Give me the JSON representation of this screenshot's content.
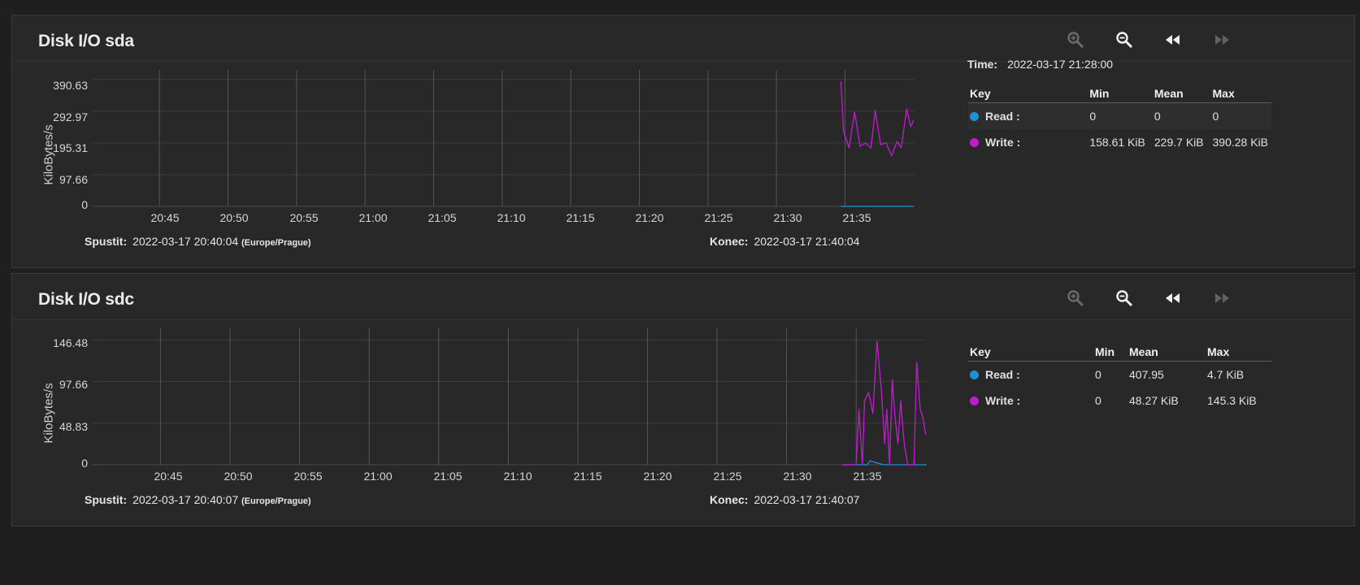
{
  "toolbar": {
    "zoom_in_icon": "zoom-in-icon",
    "zoom_out_icon": "zoom-out-icon",
    "back_icon": "rewind-icon",
    "forward_icon": "fast-forward-icon"
  },
  "colors": {
    "read": "#1a93d6",
    "write": "#c21ad1",
    "grid": "#3c3c3c",
    "vgrid": "#555555"
  },
  "legend_headers": {
    "key": "Key",
    "min": "Min",
    "mean": "Mean",
    "max": "Max"
  },
  "panels": [
    {
      "title": "Disk I/O sda",
      "ylabel": "KiloBytes/s",
      "time_label": "Time:",
      "time_value": "2022-03-17 21:28:00",
      "start_label": "Spustit:",
      "start_value": "2022-03-17 20:40:04",
      "start_tz": "(Europe/Prague)",
      "end_label": "Konec:",
      "end_value": "2022-03-17 21:40:04",
      "legend": [
        {
          "key": "Read :",
          "min": "0",
          "mean": "0",
          "max": "0"
        },
        {
          "key": "Write :",
          "min": "158.61 KiB",
          "mean": "229.7 KiB",
          "max": "390.28 KiB"
        }
      ]
    },
    {
      "title": "Disk I/O sdc",
      "ylabel": "KiloBytes/s",
      "start_label": "Spustit:",
      "start_value": "2022-03-17 20:40:07",
      "start_tz": "(Europe/Prague)",
      "end_label": "Konec:",
      "end_value": "2022-03-17 21:40:07",
      "legend": [
        {
          "key": "Read :",
          "min": "0",
          "mean": "407.95",
          "max": "4.7 KiB"
        },
        {
          "key": "Write :",
          "min": "0",
          "mean": "48.27 KiB",
          "max": "145.3 KiB"
        }
      ]
    }
  ],
  "chart_data": [
    {
      "type": "line",
      "x_ticks": [
        "20:45",
        "20:50",
        "20:55",
        "21:00",
        "21:05",
        "21:10",
        "21:15",
        "21:20",
        "21:25",
        "21:30",
        "21:35"
      ],
      "y_ticks": [
        "390.63",
        "292.97",
        "195.31",
        "97.66",
        "0"
      ],
      "y_tick_values": [
        390.63,
        292.97,
        195.31,
        97.66,
        0
      ],
      "ylabel": "KiloBytes/s",
      "xlim_minutes": [
        40.07,
        100.07
      ],
      "ylim": [
        0,
        420
      ],
      "series": [
        {
          "name": "Read",
          "x_minutes": [
            94.7,
            100.0
          ],
          "values": [
            0,
            0
          ]
        },
        {
          "name": "Write",
          "x_minutes": [
            94.7,
            94.9,
            95.3,
            95.7,
            96.1,
            96.5,
            96.9,
            97.2,
            97.6,
            98.0,
            98.4,
            98.8,
            99.1,
            99.5,
            99.8,
            100.0
          ],
          "values": [
            385,
            230,
            180,
            290,
            185,
            195,
            180,
            295,
            190,
            195,
            155,
            200,
            180,
            300,
            245,
            265
          ]
        }
      ]
    },
    {
      "type": "line",
      "x_ticks": [
        "20:45",
        "20:50",
        "20:55",
        "21:00",
        "21:05",
        "21:10",
        "21:15",
        "21:20",
        "21:25",
        "21:30",
        "21:35"
      ],
      "y_ticks": [
        "146.48",
        "97.66",
        "48.83",
        "0"
      ],
      "y_tick_values": [
        146.48,
        97.66,
        48.83,
        0
      ],
      "ylabel": "KiloBytes/s",
      "xlim_minutes": [
        40.07,
        100.07
      ],
      "ylim": [
        0,
        160
      ],
      "series": [
        {
          "name": "Read",
          "x_minutes": [
            94.0,
            95.8,
            96.0,
            96.5,
            97.0,
            100.07
          ],
          "values": [
            0,
            0,
            4.7,
            2,
            0,
            0
          ]
        },
        {
          "name": "Write",
          "x_minutes": [
            94.0,
            95.0,
            95.2,
            95.45,
            95.6,
            95.9,
            96.2,
            96.5,
            96.8,
            97.05,
            97.2,
            97.4,
            97.6,
            97.8,
            98.0,
            98.2,
            98.45,
            98.7,
            98.9,
            99.15,
            99.35,
            99.6,
            99.8,
            100.0
          ],
          "values": [
            0,
            0,
            65,
            0,
            75,
            85,
            60,
            145,
            90,
            25,
            65,
            0,
            100,
            55,
            25,
            75,
            25,
            0,
            0,
            0,
            120,
            65,
            55,
            35
          ]
        }
      ]
    }
  ]
}
